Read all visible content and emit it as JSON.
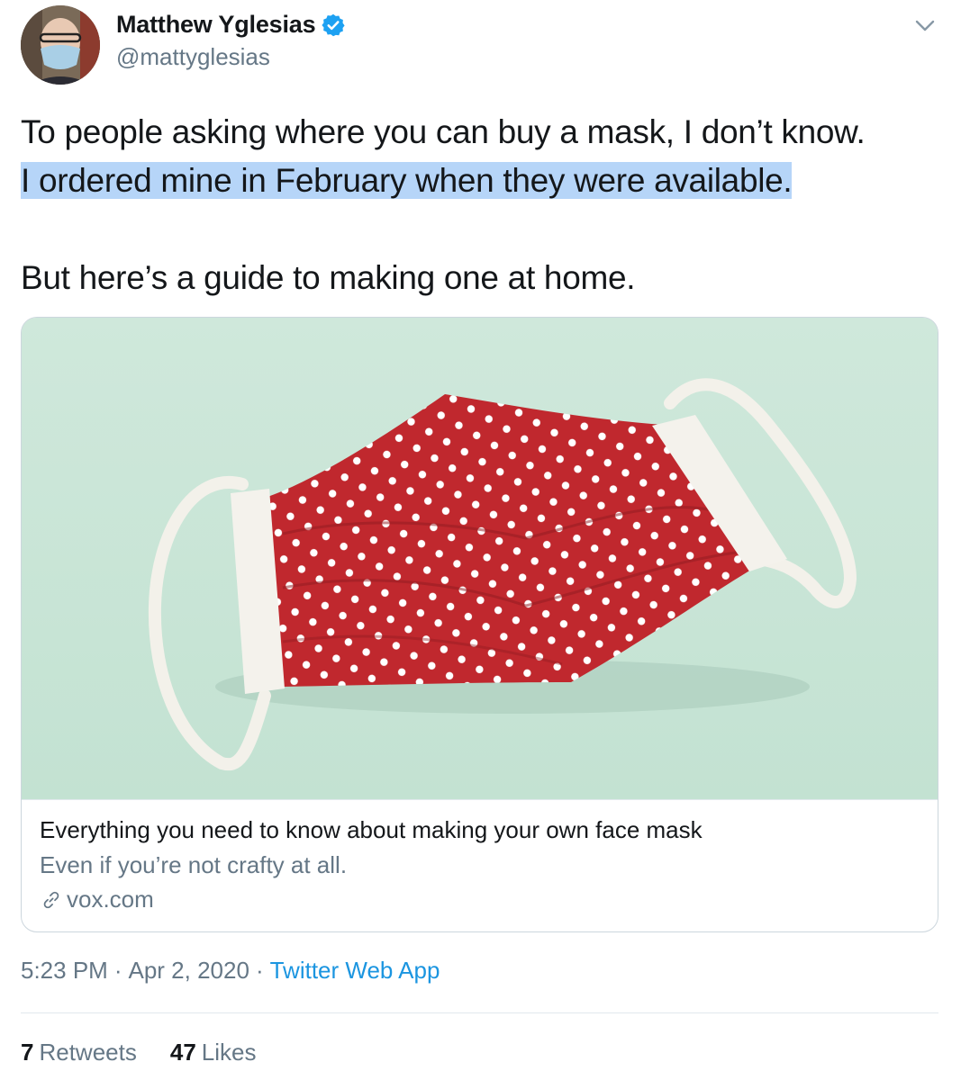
{
  "author": {
    "display_name": "Matthew Yglesias",
    "handle": "@mattyglesias",
    "verified": true,
    "avatar_icon": "profile-photo"
  },
  "menu_icon": "chevron-down-icon",
  "tweet": {
    "lines": [
      "To people asking where you can buy a mask, I don’t know.",
      "I ordered mine in February when they were available.",
      "But here’s a guide to making one at home."
    ],
    "highlighted_line_index": 1,
    "highlight_color": "#b6d5f8"
  },
  "card": {
    "image_description_icon": "red-polka-dot-face-mask-photo",
    "title": "Everything you need to know about making your own face mask",
    "description": "Even if you’re not crafty at all.",
    "domain": "vox.com",
    "domain_icon": "link-icon"
  },
  "meta": {
    "time": "5:23 PM",
    "separator": "·",
    "date": "Apr 2, 2020",
    "source": "Twitter Web App"
  },
  "stats": {
    "retweets_count": "7",
    "retweets_label": "Retweets",
    "likes_count": "47",
    "likes_label": "Likes"
  },
  "colors": {
    "text_primary": "#14171a",
    "text_secondary": "#657786",
    "link_blue": "#1b95e0",
    "verified_blue": "#1da1f2",
    "border": "#ccd6dd"
  }
}
